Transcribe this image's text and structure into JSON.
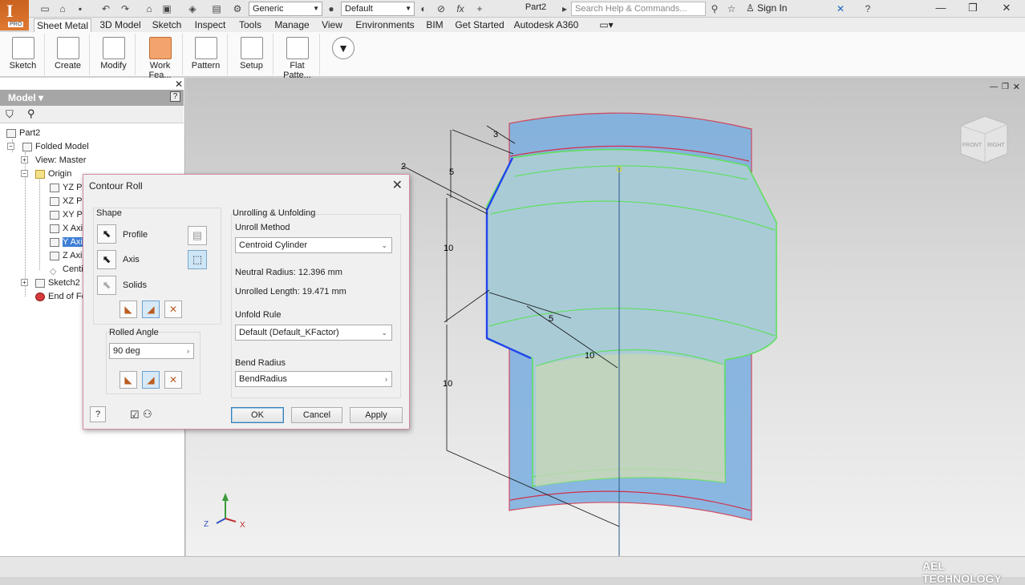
{
  "app": {
    "logo_letter": "I",
    "edition": "PRO",
    "document_title": "Part2",
    "help_search_placeholder": "Search Help & Commands...",
    "sign_in": "Sign In",
    "material_combo": "Generic",
    "appearance_combo": "Default",
    "fx_symbol": "fx"
  },
  "ribbon": {
    "tabs": [
      "Sheet Metal",
      "3D Model",
      "Sketch",
      "Inspect",
      "Tools",
      "Manage",
      "View",
      "Environments",
      "BIM",
      "Get Started",
      "Autodesk A360"
    ],
    "active_tab": 0,
    "panels": [
      "Sketch",
      "Create",
      "Modify",
      "Work Fea...",
      "Pattern",
      "Setup",
      "Flat Patte..."
    ]
  },
  "model_browser": {
    "header": "Model",
    "tree": [
      {
        "label": "Part2",
        "level": 0
      },
      {
        "label": "Folded Model",
        "level": 1
      },
      {
        "label": "View: Master",
        "level": 2
      },
      {
        "label": "Origin",
        "level": 2
      },
      {
        "label": "YZ Pla",
        "level": 3
      },
      {
        "label": "XZ Pla",
        "level": 3
      },
      {
        "label": "XY Pla",
        "level": 3
      },
      {
        "label": "X Axis",
        "level": 3
      },
      {
        "label": "Y Axis",
        "level": 3,
        "selected": true
      },
      {
        "label": "Z Axis",
        "level": 3
      },
      {
        "label": "Centi",
        "level": 3
      },
      {
        "label": "Sketch2",
        "level": 2
      },
      {
        "label": "End of Fo",
        "level": 2
      }
    ]
  },
  "dialog": {
    "title": "Contour Roll",
    "shape_group": "Shape",
    "profile": "Profile",
    "axis": "Axis",
    "solids": "Solids",
    "rolled_angle_label": "Rolled Angle",
    "rolled_angle_value": "90 deg",
    "unrolling_group": "Unrolling & Unfolding",
    "unroll_method_label": "Unroll Method",
    "unroll_method_value": "Centroid Cylinder",
    "neutral_radius": "Neutral Radius: 12.396 mm",
    "unrolled_length": "Unrolled Length: 19.471 mm",
    "unfold_rule_label": "Unfold Rule",
    "unfold_rule_value": "Default (Default_KFactor)",
    "bend_radius_label": "Bend Radius",
    "bend_radius_value": "BendRadius",
    "ok": "OK",
    "cancel": "Cancel",
    "apply": "Apply",
    "help": "?"
  },
  "viewport": {
    "dimensions": [
      "3",
      "2",
      "5",
      "10",
      "5",
      "10",
      "10"
    ],
    "viewcube_faces": [
      "FRONT",
      "RIGHT"
    ],
    "triad": [
      "Z",
      "X"
    ],
    "colors": {
      "body": "#9fc4d6",
      "edge_green": "#5ee05e",
      "edge_red": "#d0304a",
      "highlight_blue": "#2244ee"
    }
  },
  "watermark": "AEL TECHNOLOGY"
}
